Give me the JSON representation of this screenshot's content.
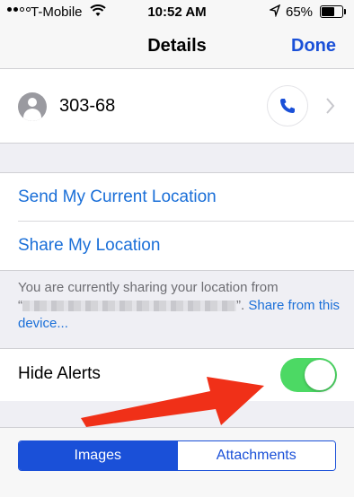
{
  "status_bar": {
    "carrier": "T-Mobile",
    "time": "10:52 AM",
    "battery_percent": "65%",
    "battery_level": 0.65,
    "icons": [
      "signal-dots",
      "wifi-icon",
      "location-arrow-icon",
      "battery-icon"
    ]
  },
  "nav": {
    "title": "Details",
    "done_label": "Done"
  },
  "contact": {
    "name": "303-68",
    "icons": [
      "avatar-icon",
      "phone-icon",
      "chevron-right-icon"
    ]
  },
  "location": {
    "send_label": "Send My Current Location",
    "share_label": "Share My Location",
    "note_prefix": "You are currently sharing your location from",
    "note_open_quote": "“",
    "note_close_quote": "”.",
    "note_link": "Share from this device..."
  },
  "alerts": {
    "label": "Hide Alerts",
    "enabled": true
  },
  "segments": {
    "images": "Images",
    "attachments": "Attachments",
    "selected": "Images"
  },
  "colors": {
    "accent": "#1a50d8",
    "link": "#1a6fd8",
    "toggle_on": "#4cd964",
    "annotation_arrow": "#f03018"
  }
}
